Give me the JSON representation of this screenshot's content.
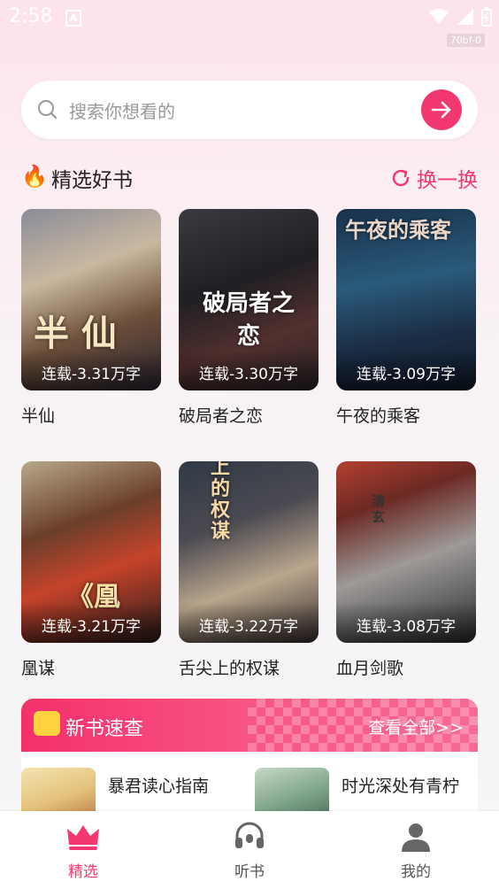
{
  "status": {
    "time": "2:58",
    "app_icon": "A",
    "version_tag": "70bf-0"
  },
  "search": {
    "placeholder": "搜索你想看的"
  },
  "section": {
    "title": "精选好书",
    "refresh_label": "换一换"
  },
  "books": [
    {
      "name": "半仙",
      "badge": "连载-3.31万字",
      "cover_text": "半 仙"
    },
    {
      "name": "破局者之恋",
      "badge": "连载-3.30万字",
      "cover_text": "破局者之恋"
    },
    {
      "name": "午夜的乘客",
      "badge": "连载-3.09万字",
      "cover_text": "午夜的乘客"
    },
    {
      "name": "凰谋",
      "badge": "连载-3.21万字",
      "cover_text": "《凰"
    },
    {
      "name": "舌尖上的权谋",
      "badge": "连载-3.22万字",
      "cover_text": "上的权谋"
    },
    {
      "name": "血月剑歌",
      "badge": "连载-3.08万字",
      "cover_text": "清玄"
    }
  ],
  "new_books": {
    "title": "新书速查",
    "view_all": "查看全部>>",
    "items": [
      {
        "name": "暴君读心指南",
        "tag": ""
      },
      {
        "name": "时光深处有青柠",
        "tag": ""
      }
    ]
  },
  "tabs": [
    {
      "label": "精选",
      "icon": "crown-icon",
      "active": true
    },
    {
      "label": "听书",
      "icon": "headphones-icon",
      "active": false
    },
    {
      "label": "我的",
      "icon": "person-icon",
      "active": false
    }
  ],
  "colors": {
    "accent": "#f2386f",
    "tab_inactive": "#555555"
  }
}
